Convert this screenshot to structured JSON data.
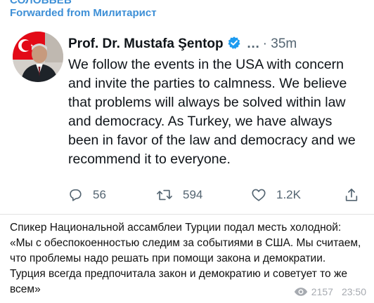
{
  "message": {
    "channel_clipped": "СОЛОВЬЁВ",
    "forwarded_prefix": "Forwarded from",
    "forwarded_source": "Милитарист",
    "caption": "Спикер Национальной ассамблеи Турции подал месть холодной: «Мы с обеспокоенностью следим за событиями в США. Мы считаем, что проблемы надо решать при помощи закона и демократии. Турция всегда предпочитала закон и демократию и советует то же всем»",
    "views": "2157",
    "time": "23:50"
  },
  "tweet": {
    "author": "Prof. Dr. Mustafa Şentop",
    "more": "…",
    "age": "35m",
    "text": "We follow the events in the USA with concern and invite the parties to calmness. We believe that problems will always be solved within law and democracy. As Turkey, we have always been in favor of the law and democracy and we recommend it to everyone.",
    "replies": "56",
    "retweets": "594",
    "likes": "1.2K"
  },
  "colors": {
    "accent": "#3d8fd6",
    "twitter_blue": "#1d9bf0",
    "muted": "#536471",
    "flag_red": "#e30a17"
  },
  "icons": [
    "verified-badge-icon",
    "reply-icon",
    "retweet-icon",
    "like-icon",
    "share-icon",
    "views-eye-icon"
  ]
}
